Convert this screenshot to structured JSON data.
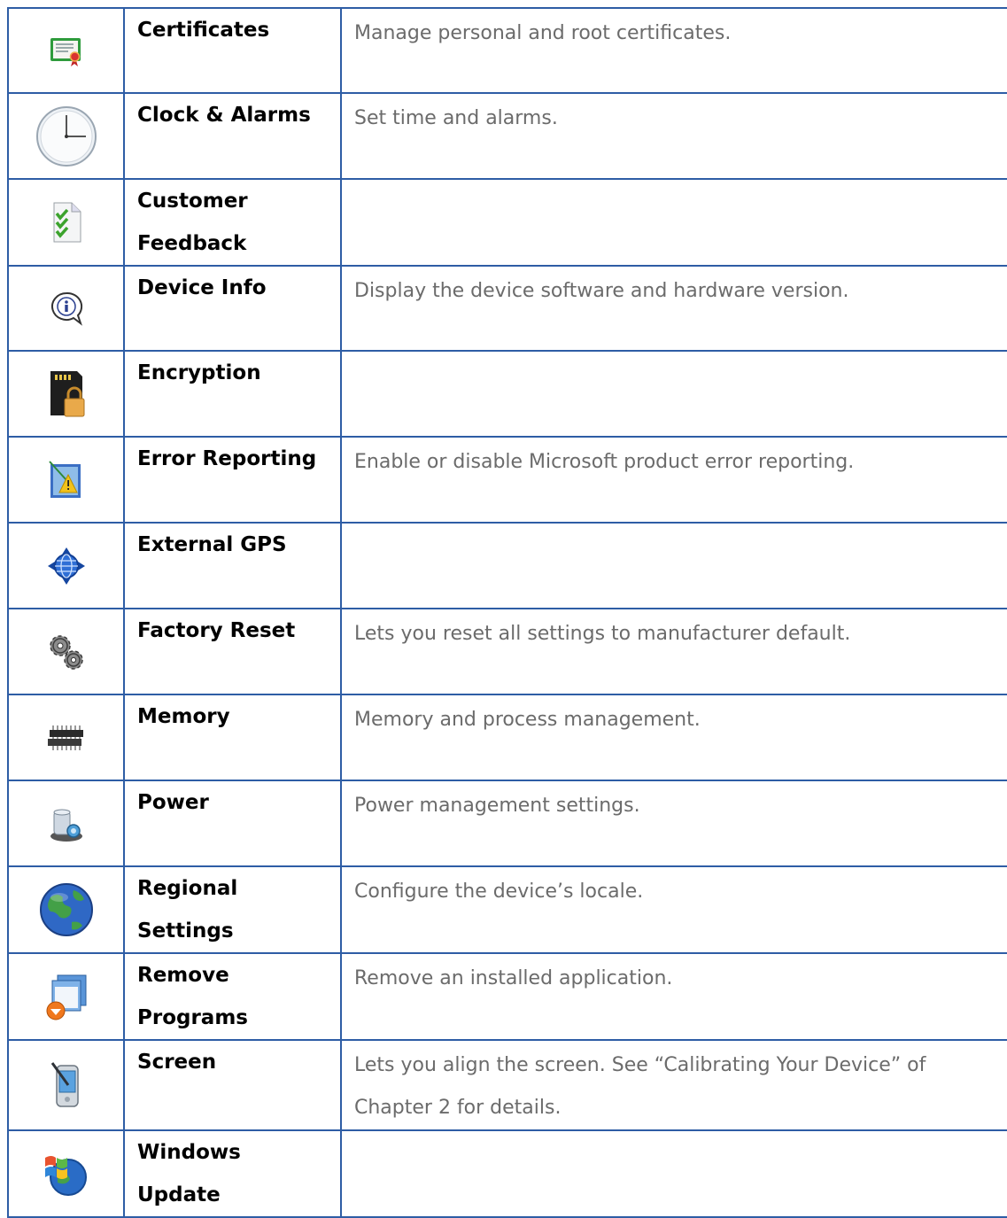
{
  "rows": [
    {
      "icon": "certificate-icon",
      "name": "Certificates",
      "desc": "Manage personal and root certificates."
    },
    {
      "icon": "clock-icon",
      "name": "Clock & Alarms",
      "desc": "Set time and alarms."
    },
    {
      "icon": "feedback-checklist-icon",
      "name": "Customer Feedback",
      "desc": ""
    },
    {
      "icon": "info-icon",
      "name": "Device Info",
      "desc": "Display the device software and hardware version."
    },
    {
      "icon": "encryption-card-lock-icon",
      "name": "Encryption",
      "desc": ""
    },
    {
      "icon": "error-warning-icon",
      "name": "Error Reporting",
      "desc": "Enable or disable Microsoft product error reporting."
    },
    {
      "icon": "gps-globe-icon",
      "name": "External GPS",
      "desc": ""
    },
    {
      "icon": "gears-icon",
      "name": "Factory Reset",
      "desc": "Lets you reset all settings to manufacturer default."
    },
    {
      "icon": "memory-chip-icon",
      "name": "Memory",
      "desc": "Memory and process management."
    },
    {
      "icon": "battery-power-icon",
      "name": "Power",
      "desc": "Power management settings."
    },
    {
      "icon": "earth-globe-icon",
      "name": "Regional Settings",
      "desc": "Configure the device’s locale."
    },
    {
      "icon": "remove-programs-icon",
      "name": "Remove Programs",
      "desc": "Remove an installed application."
    },
    {
      "icon": "screen-stylus-icon",
      "name": "Screen",
      "desc": "Lets you align the screen. See “Calibrating Your Device” of Chapter 2 for details."
    },
    {
      "icon": "windows-update-icon",
      "name": "Windows Update",
      "desc": ""
    }
  ]
}
